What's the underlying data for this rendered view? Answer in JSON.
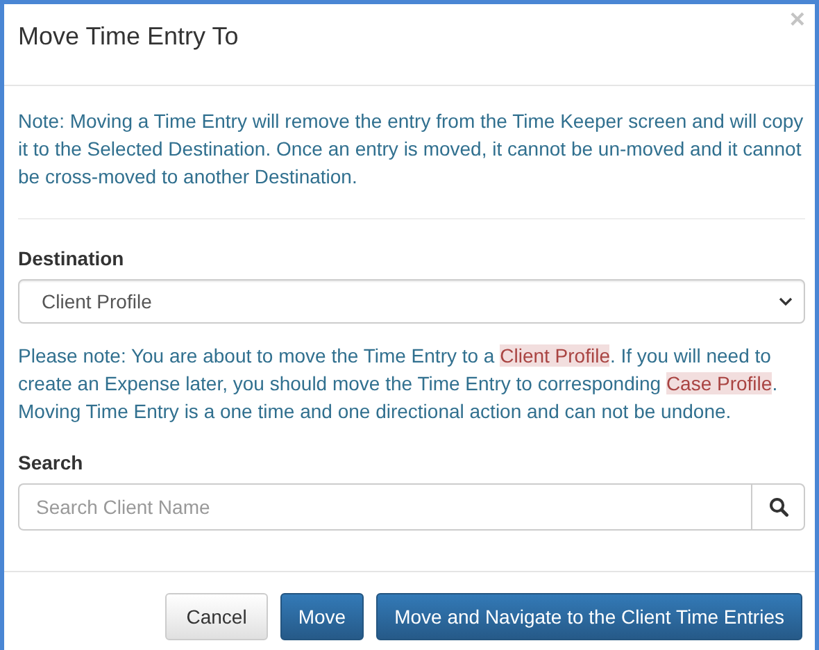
{
  "dialog": {
    "title": "Move Time Entry To",
    "close": "×"
  },
  "note": "Note: Moving a Time Entry will remove the entry from the Time Keeper screen and will copy it to the Selected Destination. Once an entry is moved, it cannot be un-moved and it cannot be cross-moved to another Destination.",
  "destination": {
    "label": "Destination",
    "value": "Client Profile"
  },
  "warning": [
    {
      "text": "Please note: You are about to move the Time Entry to a ",
      "highlight": false
    },
    {
      "text": "Client Profile",
      "highlight": true
    },
    {
      "text": ". If you will need to create an Expense later, you should move the Time Entry to corresponding ",
      "highlight": false
    },
    {
      "text": "Case Profile",
      "highlight": true
    },
    {
      "text": ". Moving Time Entry is a one time and one directional action and can not be undone.",
      "highlight": false
    }
  ],
  "search": {
    "label": "Search",
    "placeholder": "Search Client Name"
  },
  "buttons": [
    {
      "label": "Cancel",
      "kind": "default"
    },
    {
      "label": "Move",
      "kind": "primary"
    },
    {
      "label": "Move and Navigate to the Client Time Entries",
      "kind": "primary"
    }
  ]
}
